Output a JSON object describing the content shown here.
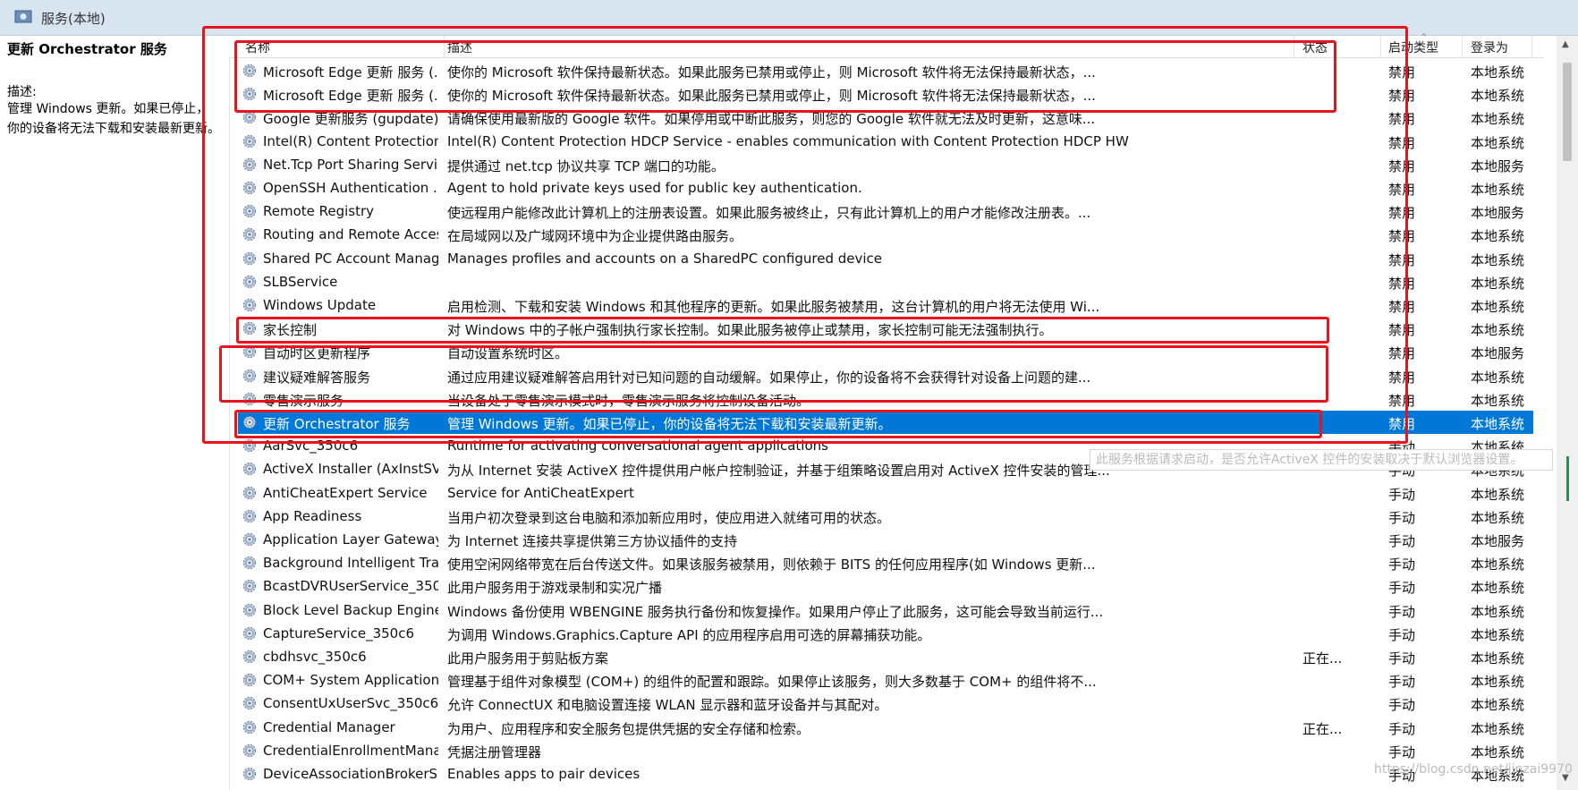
{
  "window": {
    "title": "服务(本地)"
  },
  "left_pane": {
    "service_title": "更新 Orchestrator 服务",
    "desc_label": "描述:",
    "desc_text": "管理 Windows 更新。如果已停止，你的设备将无法下载和安装最新更新。"
  },
  "columns": {
    "name": "名称",
    "desc": "描述",
    "status": "状态",
    "startup": "启动类型",
    "logon": "登录为"
  },
  "tooltip": "此服务根据请求启动，是否允许ActiveX 控件的安装取决于默认浏览器设置。",
  "watermark": "https://blog.csdn.net/jinzai9970",
  "rows": [
    {
      "name": "Microsoft Edge 更新 服务 (...",
      "desc": "使你的 Microsoft 软件保持最新状态。如果此服务已禁用或停止，则 Microsoft 软件将无法保持最新状态，...",
      "status": "",
      "startup": "禁用",
      "logon": "本地系统"
    },
    {
      "name": "Microsoft Edge 更新 服务 (...",
      "desc": "使你的 Microsoft 软件保持最新状态。如果此服务已禁用或停止，则 Microsoft 软件将无法保持最新状态，...",
      "status": "",
      "startup": "禁用",
      "logon": "本地系统"
    },
    {
      "name": "Google 更新服务 (gupdate)",
      "desc": "请确保使用最新版的 Google 软件。如果停用或中断此服务，则您的 Google 软件就无法及时更新，这意味...",
      "status": "",
      "startup": "禁用",
      "logon": "本地系统"
    },
    {
      "name": "Intel(R) Content Protection...",
      "desc": "Intel(R) Content Protection HDCP Service - enables communication with Content Protection HDCP HW",
      "status": "",
      "startup": "禁用",
      "logon": "本地系统"
    },
    {
      "name": "Net.Tcp Port Sharing Service",
      "desc": "提供通过 net.tcp 协议共享 TCP 端口的功能。",
      "status": "",
      "startup": "禁用",
      "logon": "本地服务"
    },
    {
      "name": "OpenSSH Authentication ...",
      "desc": "Agent to hold private keys used for public key authentication.",
      "status": "",
      "startup": "禁用",
      "logon": "本地系统"
    },
    {
      "name": "Remote Registry",
      "desc": "使远程用户能修改此计算机上的注册表设置。如果此服务被终止，只有此计算机上的用户才能修改注册表。...",
      "status": "",
      "startup": "禁用",
      "logon": "本地服务"
    },
    {
      "name": "Routing and Remote Access",
      "desc": "在局域网以及广域网环境中为企业提供路由服务。",
      "status": "",
      "startup": "禁用",
      "logon": "本地系统"
    },
    {
      "name": "Shared PC Account Manager",
      "desc": "Manages profiles and accounts on a SharedPC configured device",
      "status": "",
      "startup": "禁用",
      "logon": "本地系统"
    },
    {
      "name": "SLBService",
      "desc": "",
      "status": "",
      "startup": "禁用",
      "logon": "本地系统"
    },
    {
      "name": "Windows Update",
      "desc": "启用检测、下载和安装 Windows 和其他程序的更新。如果此服务被禁用，这台计算机的用户将无法使用 Wi...",
      "status": "",
      "startup": "禁用",
      "logon": "本地系统"
    },
    {
      "name": "家长控制",
      "desc": "对 Windows 中的子帐户强制执行家长控制。如果此服务被停止或禁用，家长控制可能无法强制执行。",
      "status": "",
      "startup": "禁用",
      "logon": "本地系统"
    },
    {
      "name": "自动时区更新程序",
      "desc": "自动设置系统时区。",
      "status": "",
      "startup": "禁用",
      "logon": "本地服务"
    },
    {
      "name": "建议疑难解答服务",
      "desc": "通过应用建议疑难解答启用针对已知问题的自动缓解。如果停止，你的设备将不会获得针对设备上问题的建...",
      "status": "",
      "startup": "禁用",
      "logon": "本地系统"
    },
    {
      "name": "零售演示服务",
      "desc": "当设备处于零售演示模式时，零售演示服务将控制设备活动。",
      "status": "",
      "startup": "禁用",
      "logon": "本地系统"
    },
    {
      "name": "更新 Orchestrator 服务",
      "desc": "管理 Windows 更新。如果已停止，你的设备将无法下载和安装最新更新。",
      "status": "",
      "startup": "禁用",
      "logon": "本地系统",
      "selected": true
    },
    {
      "name": "AarSvc_350c6",
      "desc": "Runtime for activating conversational agent applications",
      "status": "",
      "startup": "手动",
      "logon": "本地系统"
    },
    {
      "name": "ActiveX Installer (AxInstSV)",
      "desc": "为从 Internet 安装 ActiveX 控件提供用户帐户控制验证，并基于组策略设置启用对 ActiveX 控件安装的管理...",
      "status": "",
      "startup": "手动",
      "logon": "本地系统"
    },
    {
      "name": "AntiCheatExpert Service",
      "desc": "Service for AntiCheatExpert",
      "status": "",
      "startup": "手动",
      "logon": "本地系统"
    },
    {
      "name": "App Readiness",
      "desc": "当用户初次登录到这台电脑和添加新应用时，使应用进入就绪可用的状态。",
      "status": "",
      "startup": "手动",
      "logon": "本地系统"
    },
    {
      "name": "Application Layer Gateway ...",
      "desc": "为 Internet 连接共享提供第三方协议插件的支持",
      "status": "",
      "startup": "手动",
      "logon": "本地服务"
    },
    {
      "name": "Background Intelligent Tra...",
      "desc": "使用空闲网络带宽在后台传送文件。如果该服务被禁用，则依赖于 BITS 的任何应用程序(如 Windows 更新...",
      "status": "",
      "startup": "手动",
      "logon": "本地系统"
    },
    {
      "name": "BcastDVRUserService_350...",
      "desc": "此用户服务用于游戏录制和实况广播",
      "status": "",
      "startup": "手动",
      "logon": "本地系统"
    },
    {
      "name": "Block Level Backup Engine ...",
      "desc": "Windows 备份使用 WBENGINE 服务执行备份和恢复操作。如果用户停止了此服务，这可能会导致当前运行...",
      "status": "",
      "startup": "手动",
      "logon": "本地系统"
    },
    {
      "name": "CaptureService_350c6",
      "desc": "为调用 Windows.Graphics.Capture API 的应用程序启用可选的屏幕捕获功能。",
      "status": "",
      "startup": "手动",
      "logon": "本地系统"
    },
    {
      "name": "cbdhsvc_350c6",
      "desc": "此用户服务用于剪贴板方案",
      "status": "正在...",
      "startup": "手动",
      "logon": "本地系统"
    },
    {
      "name": "COM+ System Application",
      "desc": "管理基于组件对象模型 (COM+) 的组件的配置和跟踪。如果停止该服务，则大多数基于 COM+ 的组件将不...",
      "status": "",
      "startup": "手动",
      "logon": "本地系统"
    },
    {
      "name": "ConsentUxUserSvc_350c6",
      "desc": "允许 ConnectUX 和电脑设置连接 WLAN 显示器和蓝牙设备并与其配对。",
      "status": "",
      "startup": "手动",
      "logon": "本地系统"
    },
    {
      "name": "Credential Manager",
      "desc": "为用户、应用程序和安全服务包提供凭据的安全存储和检索。",
      "status": "正在...",
      "startup": "手动",
      "logon": "本地系统"
    },
    {
      "name": "CredentialEnrollmentMana...",
      "desc": "凭据注册管理器",
      "status": "",
      "startup": "手动",
      "logon": "本地系统"
    },
    {
      "name": "DeviceAssociationBrokerSv...",
      "desc": "Enables apps to pair devices",
      "status": "",
      "startup": "手动",
      "logon": "本地系统"
    }
  ]
}
